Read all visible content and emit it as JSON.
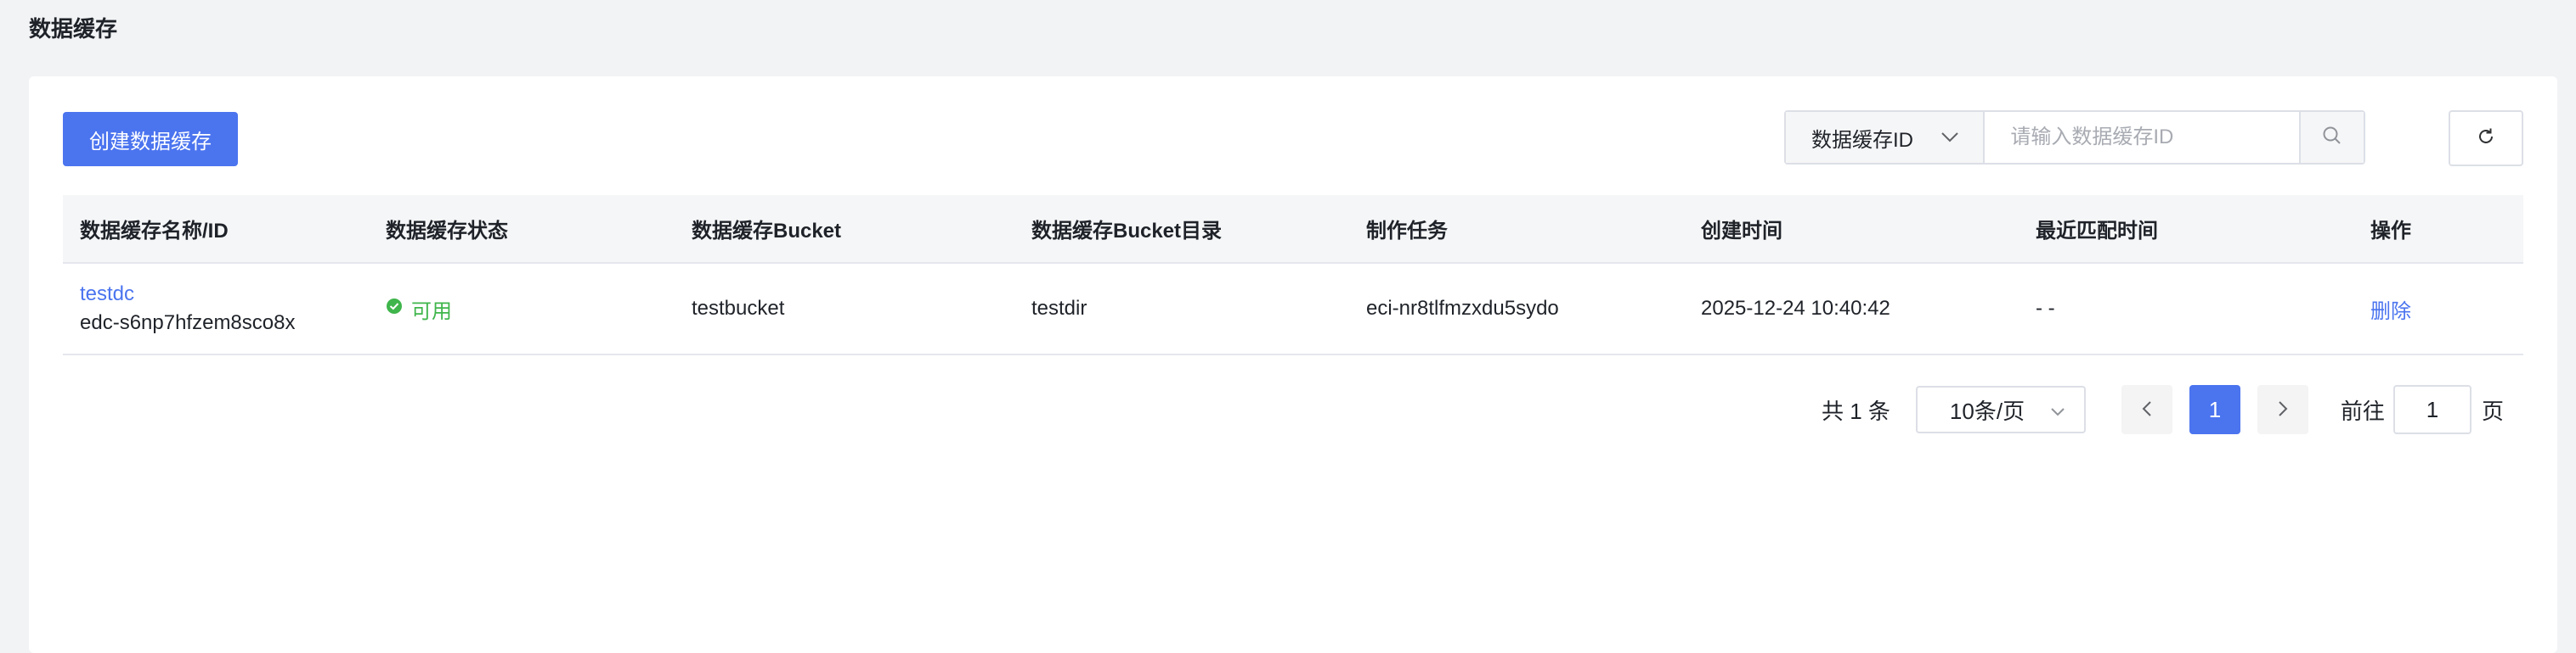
{
  "page": {
    "title": "数据缓存"
  },
  "toolbar": {
    "create_label": "创建数据缓存",
    "search_field": "数据缓存ID",
    "search_placeholder": "请输入数据缓存ID"
  },
  "table": {
    "headers": [
      "数据缓存名称/ID",
      "数据缓存状态",
      "数据缓存Bucket",
      "数据缓存Bucket目录",
      "制作任务",
      "创建时间",
      "最近匹配时间",
      "操作"
    ],
    "rows": [
      {
        "name": "testdc",
        "id": "edc-s6np7hfzem8sco8x",
        "status": "可用",
        "bucket": "testbucket",
        "bucket_dir": "testdir",
        "task": "eci-nr8tlfmzxdu5sydo",
        "created": "2025-12-24 10:40:42",
        "last_match": "- -",
        "action": "删除"
      }
    ]
  },
  "pagination": {
    "total": "共 1 条",
    "page_size": "10条/页",
    "current_page": "1",
    "goto_label": "前往",
    "goto_value": "1",
    "goto_suffix": "页"
  },
  "colors": {
    "primary": "#4b74ef",
    "success": "#3fb54b",
    "muted": "#8f959e"
  }
}
